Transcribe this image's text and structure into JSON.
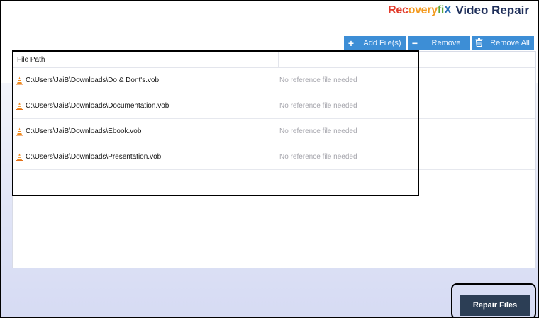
{
  "header": {
    "brand_parts": [
      "Rec",
      "overy",
      "fi",
      "X"
    ],
    "product": "Video Repair"
  },
  "toolbar": {
    "add_label": "Add File(s)",
    "remove_label": "Remove",
    "remove_all_label": "Remove All"
  },
  "table": {
    "columns": [
      "File Path",
      ""
    ],
    "rows": [
      {
        "path": "C:\\Users\\JaiB\\Downloads\\Do & Dont's.vob",
        "ref": "No reference file needed"
      },
      {
        "path": "C:\\Users\\JaiB\\Downloads\\Documentation.vob",
        "ref": "No reference file needed"
      },
      {
        "path": "C:\\Users\\JaiB\\Downloads\\Ebook.vob",
        "ref": "No reference file needed"
      },
      {
        "path": "C:\\Users\\JaiB\\Downloads\\Presentation.vob",
        "ref": "No reference file needed"
      }
    ]
  },
  "footer": {
    "repair_label": "Repair Files"
  },
  "icons": [
    "plus-icon",
    "minus-icon",
    "trash-icon",
    "vlc-cone-icon"
  ],
  "colors": {
    "toolbar_blue": "#3d8ed6",
    "repair_button": "#2c3e55",
    "placeholder_text": "#a6a6ad"
  }
}
